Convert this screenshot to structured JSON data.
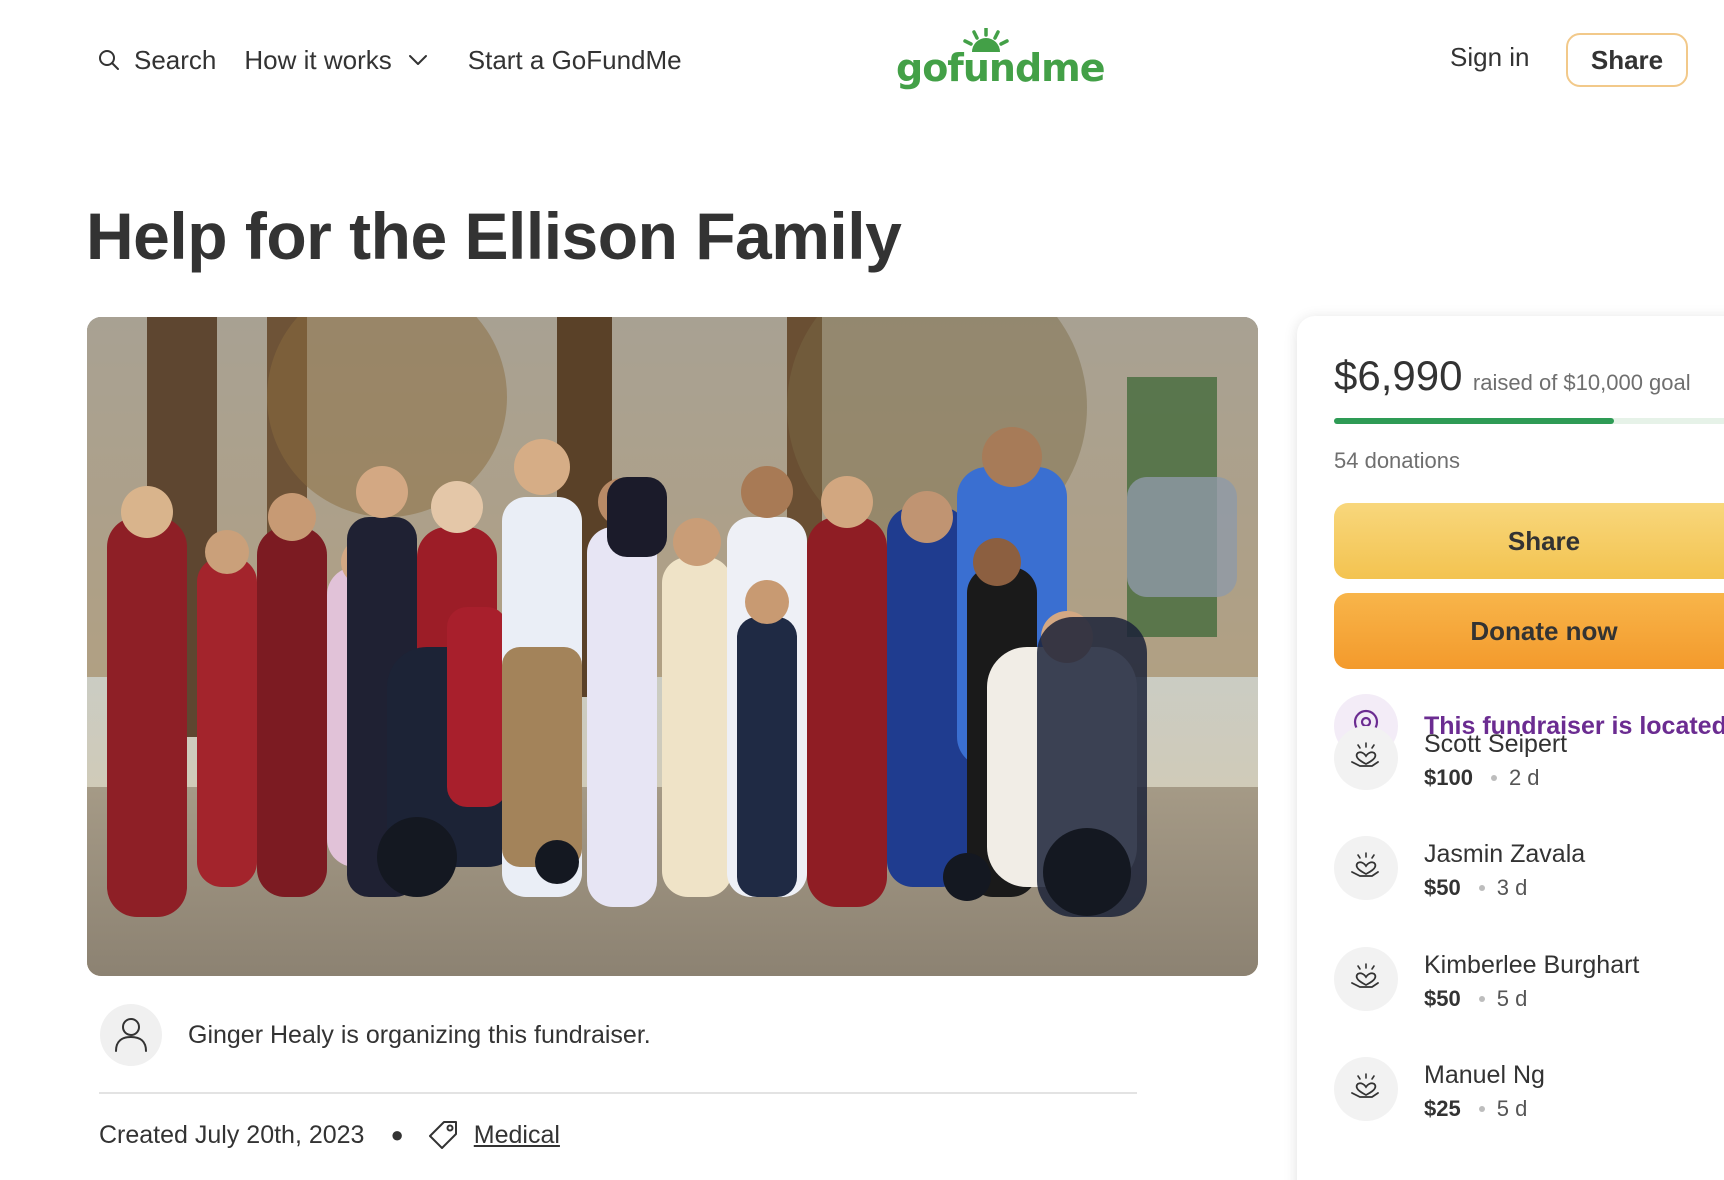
{
  "header": {
    "search_label": "Search",
    "how_it_works_label": "How it works",
    "start_label": "Start a GoFundMe",
    "logo_text": "gofundme",
    "sign_in_label": "Sign in",
    "share_label": "Share"
  },
  "campaign": {
    "title": "Help for the Ellison Family",
    "organizer_text": "Ginger Healy is organizing this fundraiser.",
    "created_text": "Created July 20th, 2023",
    "category": "Medical"
  },
  "donation_card": {
    "raised_amount": "$6,990",
    "raised_suffix": "raised of $10,000 goal",
    "progress_fraction": 0.699,
    "donations_count": "54 donations",
    "share_label": "Share",
    "donate_label": "Donate now",
    "location_text": "This fundraiser is located"
  },
  "donors": [
    {
      "name": "Scott Seipert",
      "amount": "$100",
      "time": "2 d"
    },
    {
      "name": "Jasmin Zavala",
      "amount": "$50",
      "time": "3 d"
    },
    {
      "name": "Kimberlee Burghart",
      "amount": "$50",
      "time": "5 d"
    },
    {
      "name": "Manuel Ng",
      "amount": "$25",
      "time": "5 d"
    }
  ],
  "colors": {
    "brand_green": "#43a047",
    "progress_green": "#2e9b55",
    "share_button": "#f3c350",
    "donate_button": "#f39a2c",
    "location_purple": "#6b2c91"
  },
  "icons": [
    "search-icon",
    "chevron-down-icon",
    "gofundme-logo",
    "user-icon",
    "tag-icon",
    "location-pin-icon",
    "heart-hands-icon"
  ]
}
